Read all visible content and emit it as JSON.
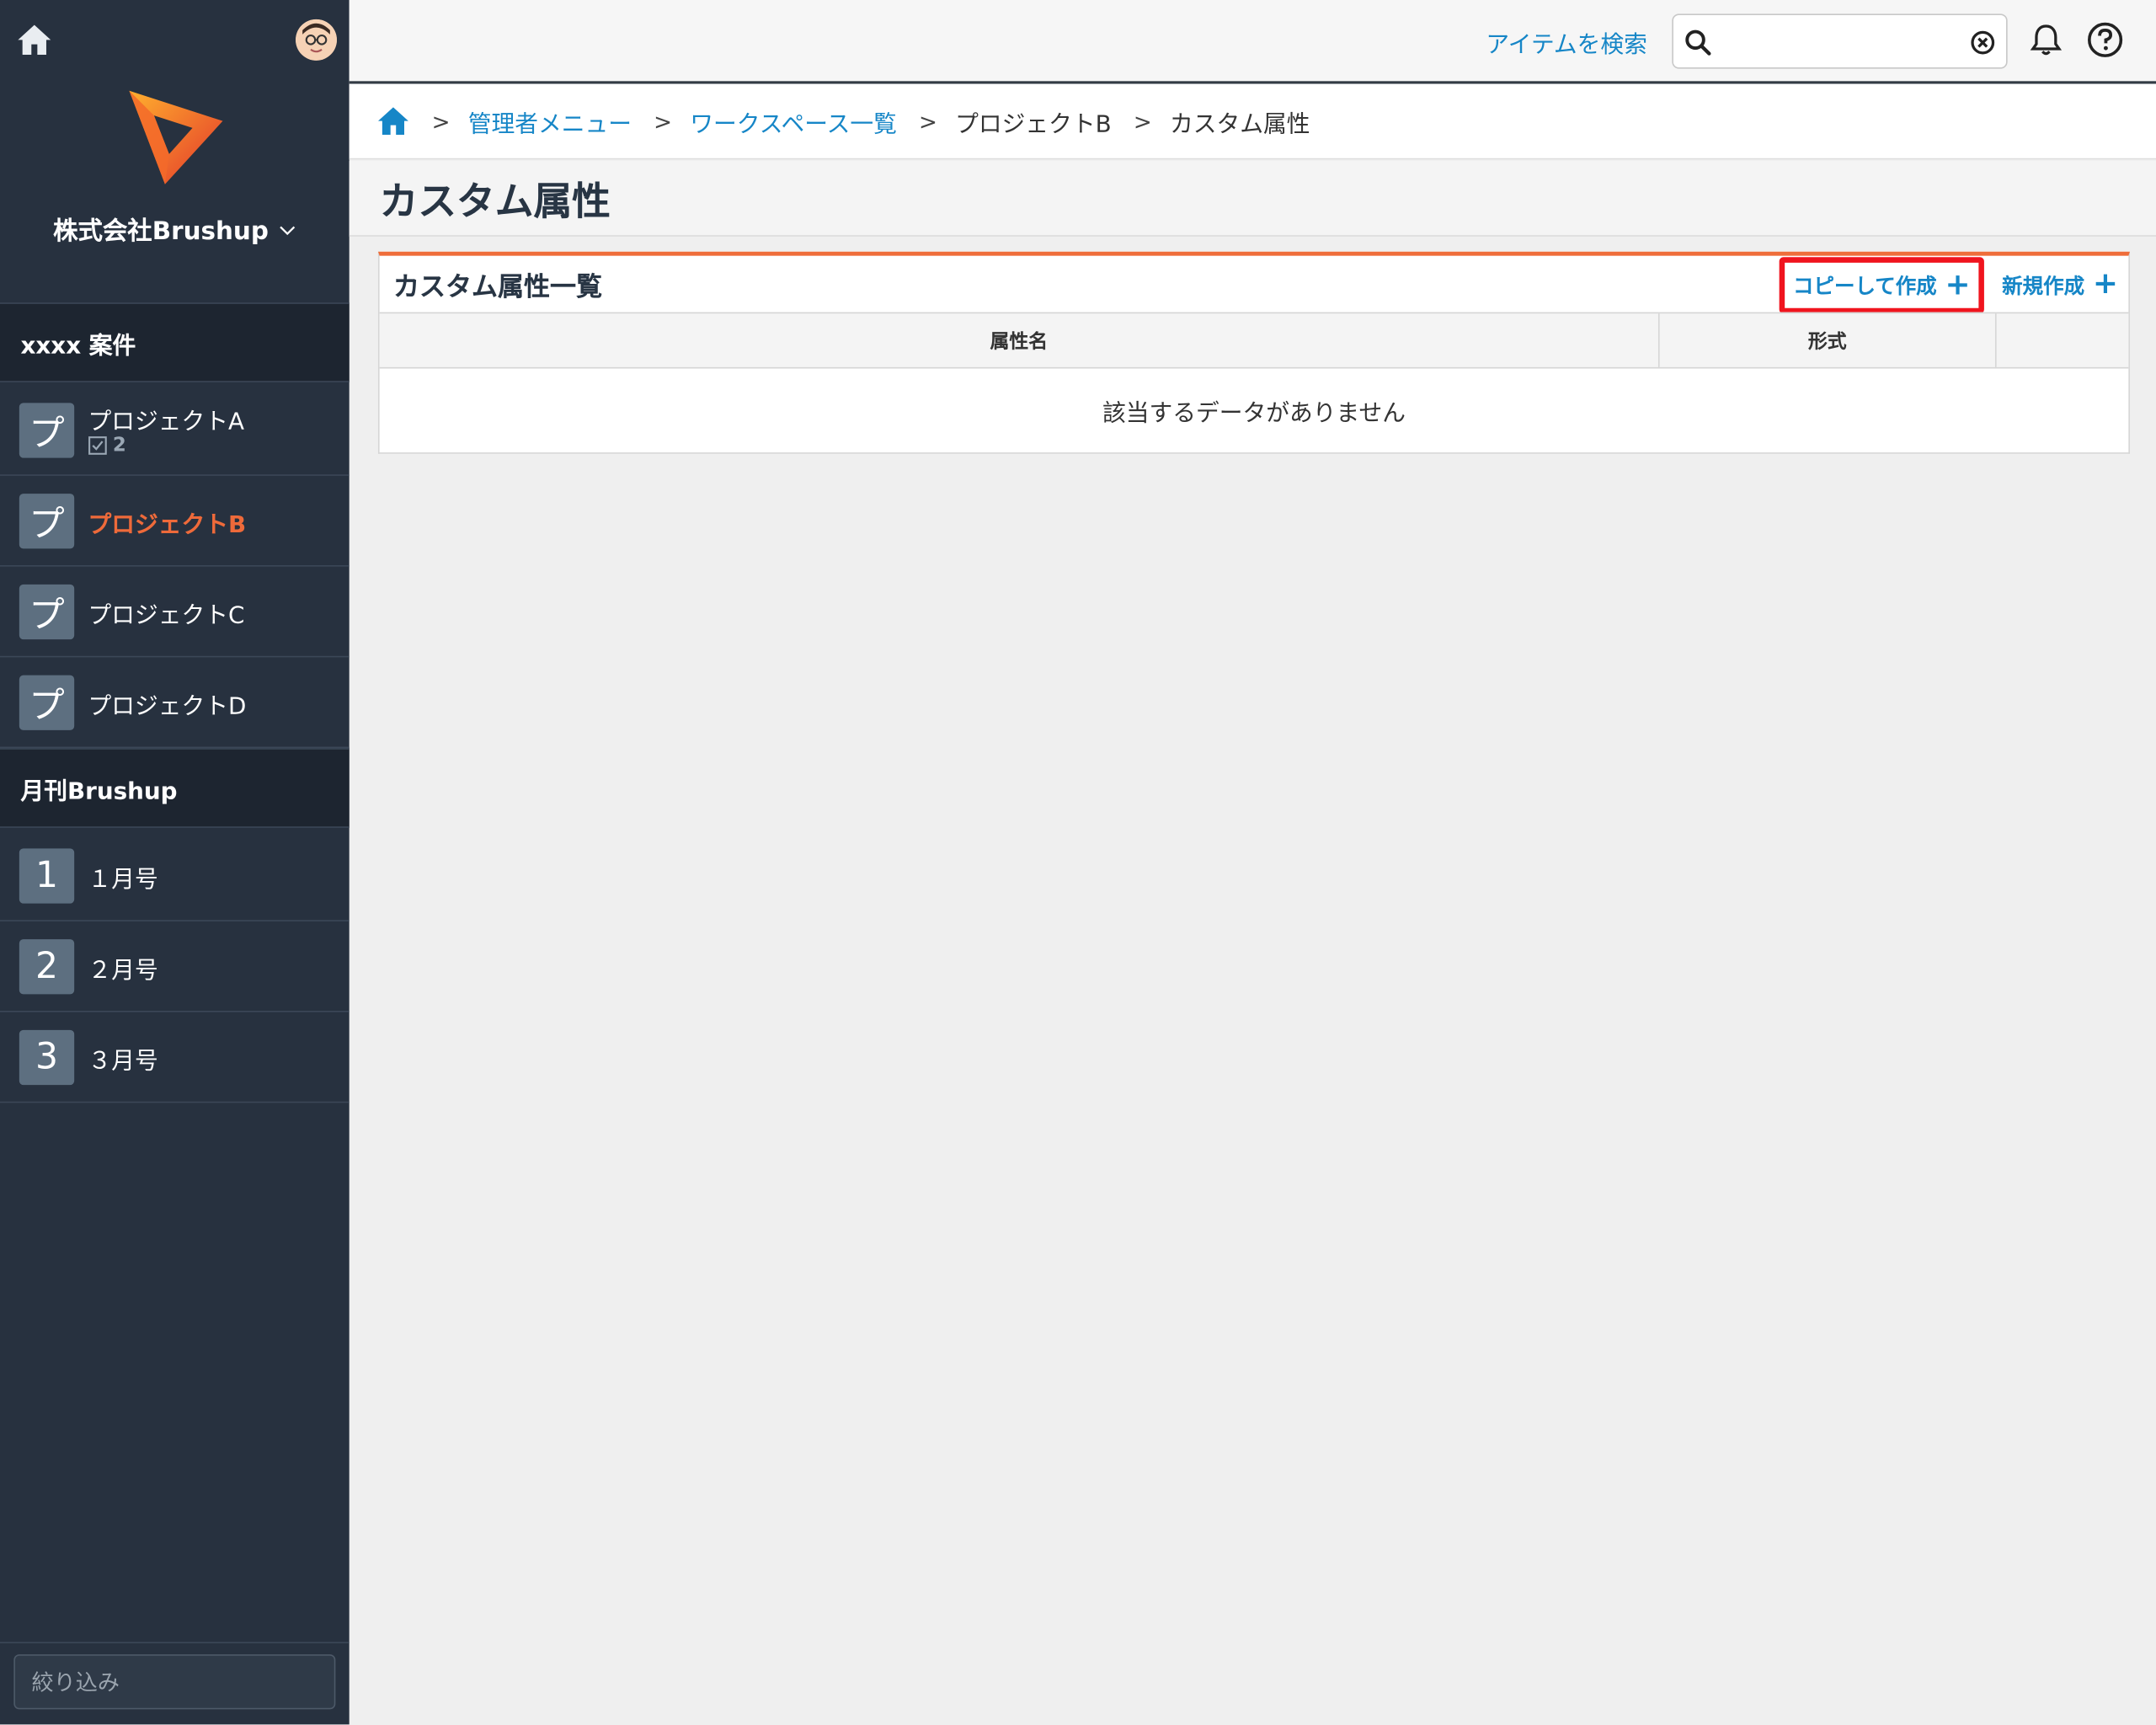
{
  "sidebar": {
    "org_name": "株式会社Brushup",
    "groups": [
      {
        "title": "xxxx 案件"
      },
      {
        "title": "月刊Brushup"
      }
    ],
    "items": [
      {
        "badge": "プ",
        "label": "プロジェクトA",
        "sub_count": "2"
      },
      {
        "badge": "プ",
        "label": "プロジェクトB"
      },
      {
        "badge": "プ",
        "label": "プロジェクトC"
      },
      {
        "badge": "プ",
        "label": "プロジェクトD"
      },
      {
        "badge": "1",
        "label": "１月号"
      },
      {
        "badge": "2",
        "label": "２月号"
      },
      {
        "badge": "3",
        "label": "３月号"
      }
    ],
    "filter_placeholder": "絞り込み"
  },
  "topbar": {
    "search_link": "アイテムを検索",
    "search_value": ""
  },
  "breadcrumb": {
    "items": [
      "管理者メニュー",
      "ワークスペース一覧",
      "プロジェクトB",
      "カスタム属性"
    ]
  },
  "page": {
    "title": "カスタム属性"
  },
  "panel": {
    "title": "カスタム属性一覧",
    "copy_label": "コピーして作成",
    "new_label": "新規作成",
    "columns": [
      "属性名",
      "形式",
      ""
    ],
    "empty_message": "該当するデータがありません"
  },
  "colors": {
    "sidebar_bg": "#27313f",
    "accent_orange": "#ef6d3a",
    "link_blue": "#1686c7",
    "highlight_red": "#f0141e"
  }
}
